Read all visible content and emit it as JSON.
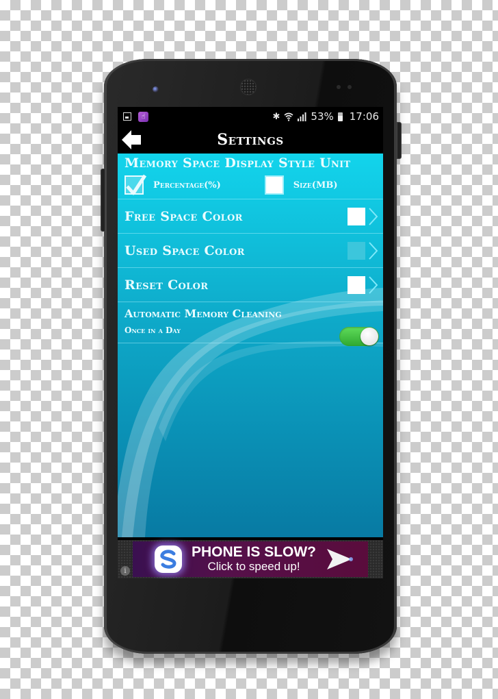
{
  "status_bar": {
    "left_icons": [
      "image-notification-icon",
      "app-notification-icon"
    ],
    "right_icons": [
      "bluetooth-icon",
      "wifi-icon",
      "signal-icon"
    ],
    "battery_percent": "53%",
    "time": "17:06"
  },
  "app_bar": {
    "back_icon": "back-arrow-icon",
    "title": "Settings"
  },
  "display_style": {
    "title": "Memory Space Display Style Unit",
    "options": [
      {
        "label": "Percentage(%)",
        "checked": true
      },
      {
        "label": "Size(MB)",
        "checked": false
      }
    ]
  },
  "color_prefs": [
    {
      "label": "Free Space Color",
      "swatch_color": "#ffffff"
    },
    {
      "label": "Used Space Color",
      "swatch_color": "#3cc6dc"
    },
    {
      "label": "Reset Color",
      "swatch_color": "#ffffff"
    }
  ],
  "auto_clean": {
    "title": "Automatic Memory Cleaning",
    "subtitle": "Once in a Day",
    "enabled": true
  },
  "ad": {
    "headline": "PHONE IS SLOW?",
    "subline": "Click to speed up!",
    "info_glyph": "i"
  },
  "colors": {
    "accent": "#12d4ec",
    "toggle_on": "#3fbf3c",
    "ad_bg": "#55104a"
  }
}
